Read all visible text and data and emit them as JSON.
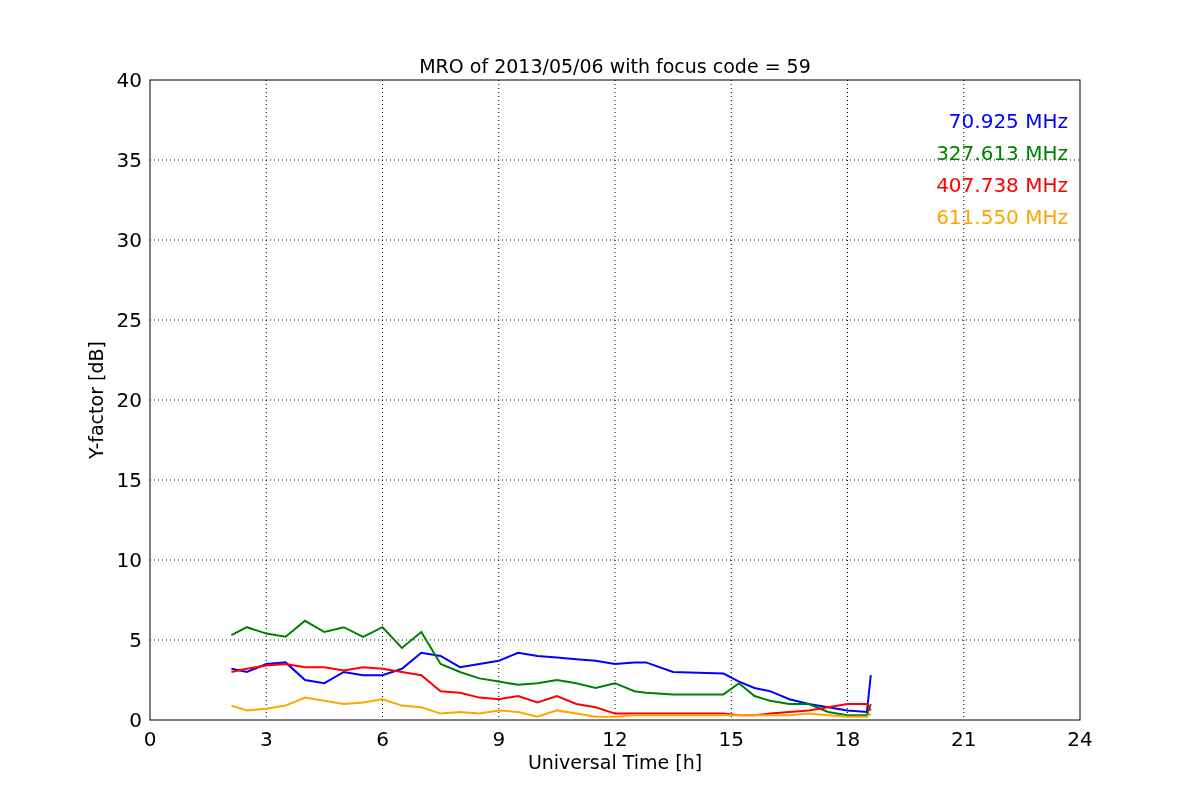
{
  "figure": {
    "chart_data": {
      "type": "line",
      "title": "MRO of 2013/05/06 with focus code = 59",
      "xlabel": "Universal Time [h]",
      "ylabel": "Y-factor [dB]",
      "x": [
        2.1,
        2.5,
        3,
        3.5,
        4,
        4.5,
        5,
        5.5,
        6,
        6.5,
        7,
        7.5,
        8,
        8.5,
        9,
        9.5,
        10,
        10.5,
        11,
        11.5,
        12,
        12.5,
        12.8,
        13.5,
        14.8,
        15.2,
        15.6,
        16,
        16.5,
        17,
        17.5,
        18,
        18.5,
        18.6
      ],
      "series": [
        {
          "name": "70.925 MHz",
          "color": "#0000ff",
          "values": [
            3.2,
            3.0,
            3.5,
            3.6,
            2.5,
            2.3,
            3.0,
            2.8,
            2.8,
            3.2,
            4.2,
            4.0,
            3.3,
            3.5,
            3.7,
            4.2,
            4.0,
            3.9,
            3.8,
            3.7,
            3.5,
            3.6,
            3.6,
            3.0,
            2.9,
            2.4,
            2.0,
            1.8,
            1.3,
            1.0,
            0.8,
            0.6,
            0.5,
            2.8
          ]
        },
        {
          "name": "327.613 MHz",
          "color": "#008000",
          "values": [
            5.3,
            5.8,
            5.4,
            5.2,
            6.2,
            5.5,
            5.8,
            5.2,
            5.8,
            4.5,
            5.5,
            3.5,
            3.0,
            2.6,
            2.4,
            2.2,
            2.3,
            2.5,
            2.3,
            2.0,
            2.3,
            1.8,
            1.7,
            1.6,
            1.6,
            2.3,
            1.5,
            1.2,
            1.0,
            1.0,
            0.5,
            0.3,
            0.3,
            1.0
          ]
        },
        {
          "name": "407.738 MHz",
          "color": "#ff0000",
          "values": [
            3.0,
            3.2,
            3.4,
            3.5,
            3.3,
            3.3,
            3.1,
            3.3,
            3.2,
            3.0,
            2.8,
            1.8,
            1.7,
            1.4,
            1.3,
            1.5,
            1.1,
            1.5,
            1.0,
            0.8,
            0.4,
            0.4,
            0.4,
            0.4,
            0.4,
            0.3,
            0.3,
            0.4,
            0.5,
            0.6,
            0.8,
            1.0,
            1.0,
            0.6
          ]
        },
        {
          "name": "611.550 MHz",
          "color": "#ffa500",
          "values": [
            0.9,
            0.6,
            0.7,
            0.9,
            1.4,
            1.2,
            1.0,
            1.1,
            1.3,
            0.9,
            0.8,
            0.4,
            0.5,
            0.4,
            0.6,
            0.5,
            0.2,
            0.6,
            0.4,
            0.2,
            0.2,
            0.3,
            0.3,
            0.3,
            0.3,
            0.3,
            0.3,
            0.3,
            0.3,
            0.4,
            0.3,
            0.2,
            0.2,
            0.4
          ]
        }
      ],
      "xlim": [
        0,
        24
      ],
      "ylim": [
        0,
        40
      ],
      "xticks": [
        0,
        3,
        6,
        9,
        12,
        15,
        18,
        21,
        24
      ],
      "yticks": [
        0,
        5,
        10,
        15,
        20,
        25,
        30,
        35,
        40
      ],
      "grid": true
    }
  }
}
